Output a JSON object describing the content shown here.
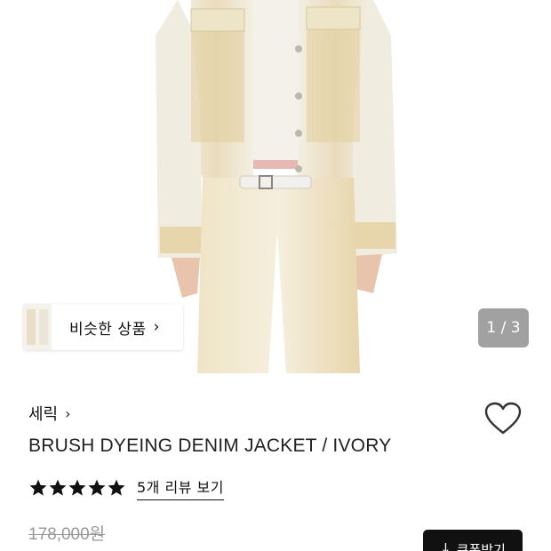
{
  "product_image": {
    "alt": "",
    "pager": "1 / 3"
  },
  "similar": {
    "label": "비슷한 상품",
    "chevron": "›"
  },
  "product": {
    "brand": "세릭",
    "brand_chevron": "›",
    "title": "BRUSH DYEING DENIM JACKET / IVORY",
    "rating_stars": 5,
    "review_link": "5개 리뷰 보기",
    "original_price": "178,000원"
  },
  "coupon": {
    "label": "쿠폰받기",
    "icon": "download-arrow-icon"
  },
  "colors": {
    "star": "#111111",
    "coupon_bg": "#111111",
    "pager_bg": "#7a7a7a"
  }
}
